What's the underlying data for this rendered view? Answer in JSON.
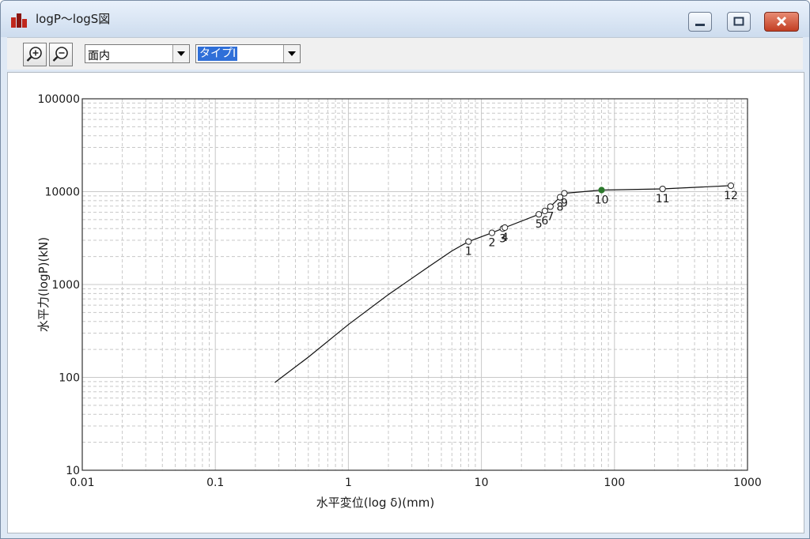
{
  "window": {
    "title": "logP～logS図"
  },
  "toolbar": {
    "plane_select": {
      "value": "面内"
    },
    "type_select": {
      "value": "タイプⅠ"
    }
  },
  "colors": {
    "highlight_point": "#2d7a2d",
    "curve": "#111111",
    "grid": "#c8c8c8"
  },
  "chart_data": {
    "type": "line",
    "xscale": "log",
    "yscale": "log",
    "xlim": [
      0.01,
      1000
    ],
    "ylim": [
      10,
      100000
    ],
    "xlabel": "水平変位(log δ)(mm)",
    "ylabel": "水平力(logP)(kN)",
    "x_tick_labels": [
      "0.01",
      "0.1",
      "1",
      "10",
      "100",
      "1000"
    ],
    "y_tick_labels": [
      "10",
      "100",
      "1000",
      "10000",
      "100000"
    ],
    "grid": true,
    "curve": [
      [
        0.28,
        88
      ],
      [
        0.5,
        165
      ],
      [
        1.0,
        370
      ],
      [
        2.0,
        780
      ],
      [
        4.0,
        1550
      ],
      [
        6.0,
        2300
      ],
      [
        8.0,
        2900
      ],
      [
        12.0,
        3600
      ],
      [
        15.0,
        4100
      ],
      [
        27.0,
        5700
      ],
      [
        30.0,
        6200
      ],
      [
        33.0,
        6900
      ],
      [
        39.0,
        8700
      ],
      [
        42.0,
        9600
      ],
      [
        80.0,
        10400
      ],
      [
        230.0,
        10700
      ],
      [
        750.0,
        11600
      ]
    ],
    "points": [
      {
        "label": "1",
        "x": 8.0,
        "y": 2900
      },
      {
        "label": "2",
        "x": 12.0,
        "y": 3600
      },
      {
        "label": "3",
        "x": 14.5,
        "y": 4000
      },
      {
        "label": "4",
        "x": 15.0,
        "y": 4100
      },
      {
        "label": "5",
        "x": 27.0,
        "y": 5700
      },
      {
        "label": "6",
        "x": 30.0,
        "y": 6200
      },
      {
        "label": "7",
        "x": 33.0,
        "y": 6900
      },
      {
        "label": "8",
        "x": 39.0,
        "y": 8700
      },
      {
        "label": "9",
        "x": 42.0,
        "y": 9600
      },
      {
        "label": "10",
        "x": 80.0,
        "y": 10400,
        "highlight": true
      },
      {
        "label": "11",
        "x": 230.0,
        "y": 10700
      },
      {
        "label": "12",
        "x": 750.0,
        "y": 11600
      }
    ]
  }
}
